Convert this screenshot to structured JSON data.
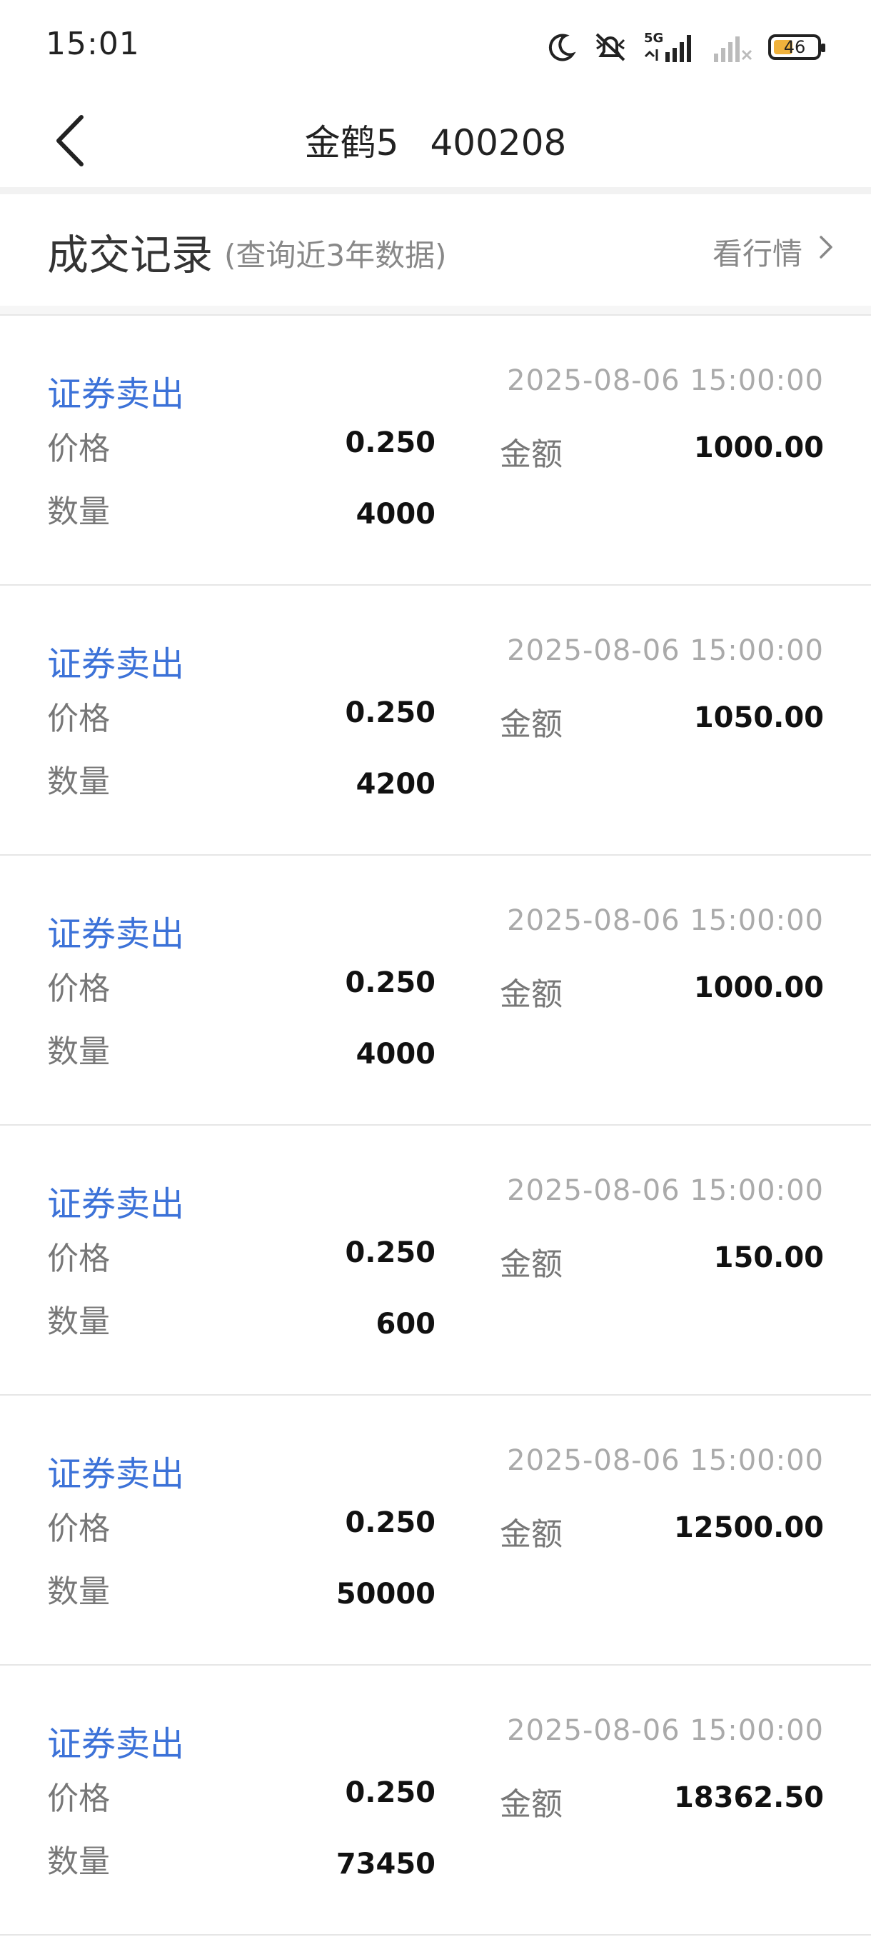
{
  "status_bar": {
    "time": "15:01",
    "network": "5G",
    "battery": "46",
    "icons": [
      "moon-icon",
      "mute-icon",
      "signal-icon",
      "signal-weak-icon",
      "battery-icon"
    ]
  },
  "header": {
    "back_icon": "back-arrow-icon",
    "stock_name": "金鹤5",
    "stock_code": "400208"
  },
  "section": {
    "title": "成交记录",
    "subtitle": "(查询近3年数据)",
    "link_label": "看行情"
  },
  "labels": {
    "price": "价格",
    "quantity": "数量",
    "amount": "金额"
  },
  "records": [
    {
      "type": "证券卖出",
      "time": "2025-08-06 15:00:00",
      "price": "0.250",
      "quantity": "4000",
      "amount": "1000.00"
    },
    {
      "type": "证券卖出",
      "time": "2025-08-06 15:00:00",
      "price": "0.250",
      "quantity": "4200",
      "amount": "1050.00"
    },
    {
      "type": "证券卖出",
      "time": "2025-08-06 15:00:00",
      "price": "0.250",
      "quantity": "4000",
      "amount": "1000.00"
    },
    {
      "type": "证券卖出",
      "time": "2025-08-06 15:00:00",
      "price": "0.250",
      "quantity": "600",
      "amount": "150.00"
    },
    {
      "type": "证券卖出",
      "time": "2025-08-06 15:00:00",
      "price": "0.250",
      "quantity": "50000",
      "amount": "12500.00"
    },
    {
      "type": "证券卖出",
      "time": "2025-08-06 15:00:00",
      "price": "0.250",
      "quantity": "73450",
      "amount": "18362.50"
    }
  ],
  "colors": {
    "accent": "#3c72d8",
    "muted": "#888888",
    "divider": "#e6e6e6",
    "battery_fill": "#f0b23c"
  }
}
